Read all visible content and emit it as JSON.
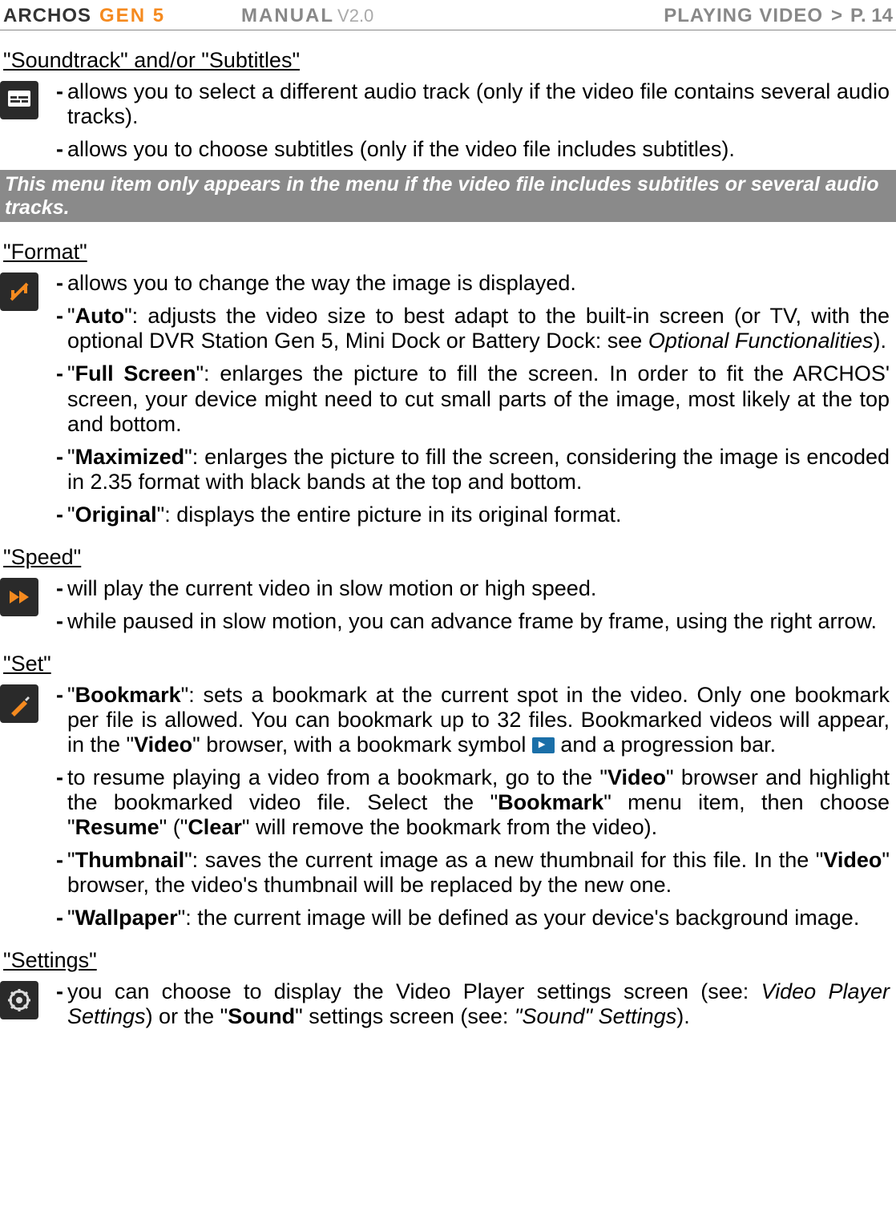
{
  "header": {
    "logo": "ARCHOS",
    "gen": "GEN 5",
    "manual": "MANUAL",
    "version": "V2.0",
    "section": "PLAYING VIDEO",
    "separator": ">",
    "page": "P. 14"
  },
  "sec_soundtrack": {
    "title": "\"Soundtrack\" and/or \"Subtitles\"",
    "b1": "allows you to select a different audio track (only if the video file contains several audio tracks).",
    "b2": "allows you to choose subtitles (only if the video file includes subtitles).",
    "note": "This menu item only appears in the menu if the video file includes subtitles or several audio tracks."
  },
  "sec_format": {
    "title": "\"Format\"",
    "b1": "allows you to change the way the image is displayed.",
    "b2_pre": "\"",
    "b2_term": "Auto",
    "b2_post": "\": adjusts the video size to best adapt to the built-in screen (or TV, with the optional DVR Station Gen 5, Mini Dock or Battery Dock: see ",
    "b2_ital": "Optional Functionalities",
    "b2_end": ").",
    "b3_pre": "\"",
    "b3_term": "Full Screen",
    "b3_post": "\": enlarges the picture to fill the screen. In order to fit the ARCHOS' screen, your device might need to cut small parts of the image, most likely at the top and bottom.",
    "b4_pre": "\"",
    "b4_term": "Maximized",
    "b4_post": "\": enlarges the picture to fill the screen, considering the image is encoded in 2.35 format with black bands at the top and bottom.",
    "b5_pre": "\"",
    "b5_term": "Original",
    "b5_post": "\": displays the entire picture in its original format."
  },
  "sec_speed": {
    "title": "\"Speed\"",
    "b1": "will play the current video in slow motion or high speed.",
    "b2": "while paused in slow motion, you can advance frame by frame, using the right arrow."
  },
  "sec_set": {
    "title": "\"Set\"",
    "b1_pre": "\"",
    "b1_term": "Bookmark",
    "b1_mid": "\": sets a bookmark at the current spot in the video. Only one bookmark per file is allowed. You can bookmark up to 32 files. Bookmarked videos will appear, in the \"",
    "b1_video": "Video",
    "b1_mid2": "\" browser, with a bookmark symbol ",
    "b1_end": " and a progression bar.",
    "b2_pre": "to resume playing a video from a bookmark, go to the \"",
    "b2_video": "Video",
    "b2_mid": "\" browser and highlight the bookmarked video file. Select the \"",
    "b2_bookmark": "Bookmark",
    "b2_mid2": "\" menu item, then choose \"",
    "b2_resume": "Resume",
    "b2_mid3": "\" (\"",
    "b2_clear": "Clear",
    "b2_end": "\" will remove the bookmark from the video).",
    "b3_pre": "\"",
    "b3_term": "Thumbnail",
    "b3_mid": "\": saves the current image as a new thumbnail for this file. In the \"",
    "b3_video": "Video",
    "b3_end": "\" browser, the video's thumbnail will be replaced by the new one.",
    "b4_pre": "\"",
    "b4_term": "Wallpaper",
    "b4_post": "\": the current image will be defined as your device's background image."
  },
  "sec_settings": {
    "title": "\"Settings\"",
    "b1_pre": "you can choose to display the Video Player settings screen (see: ",
    "b1_ital1": "Video Player Settings",
    "b1_mid": ") or the \"",
    "b1_sound": "Sound",
    "b1_mid2": "\" settings screen (see: ",
    "b1_ital2": "\"Sound\" Settings",
    "b1_end": ")."
  }
}
